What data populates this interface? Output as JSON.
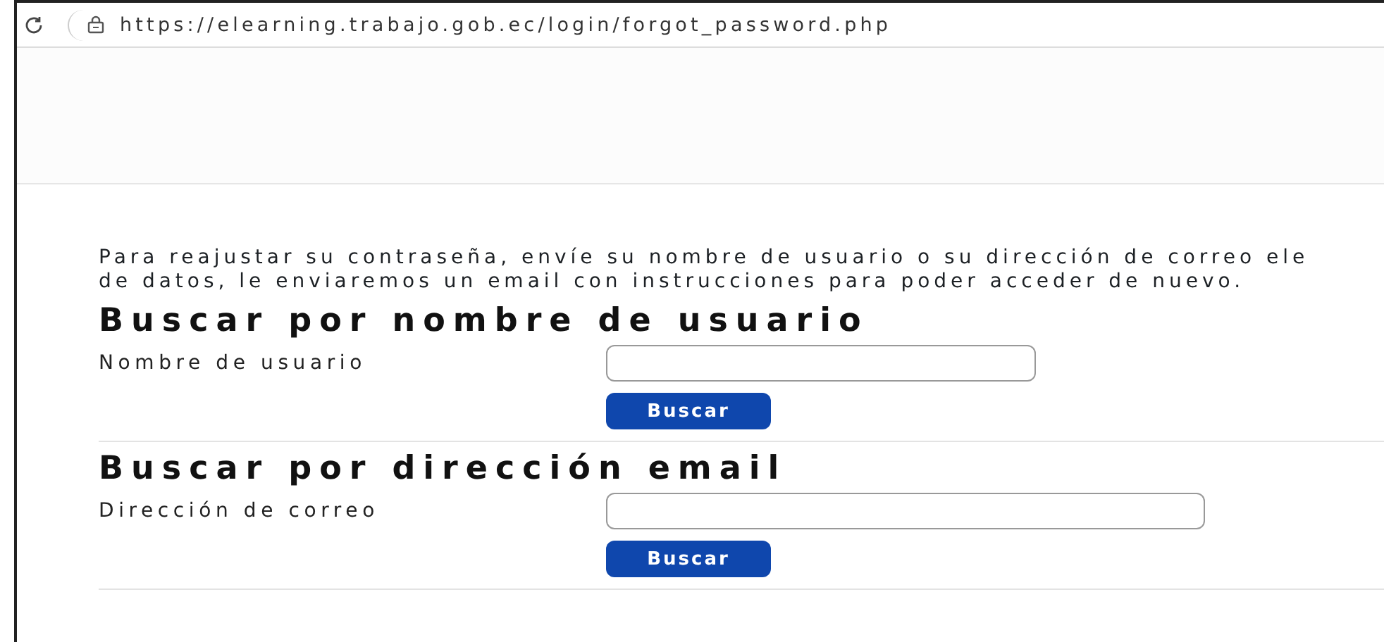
{
  "browser": {
    "url": "https://elearning.trabajo.gob.ec/login/forgot_password.php"
  },
  "intro": [
    "Para reajustar su contraseña, envíe su nombre de usuario o su dirección de correo ele",
    "de datos, le enviaremos un email con instrucciones para poder acceder de nuevo."
  ],
  "sections": [
    {
      "heading": "Buscar por nombre de usuario",
      "label": "Nombre de usuario",
      "kind": "short",
      "button": "Buscar"
    },
    {
      "heading": "Buscar por dirección email",
      "label": "Dirección de correo",
      "kind": "long",
      "button": "Buscar"
    }
  ]
}
